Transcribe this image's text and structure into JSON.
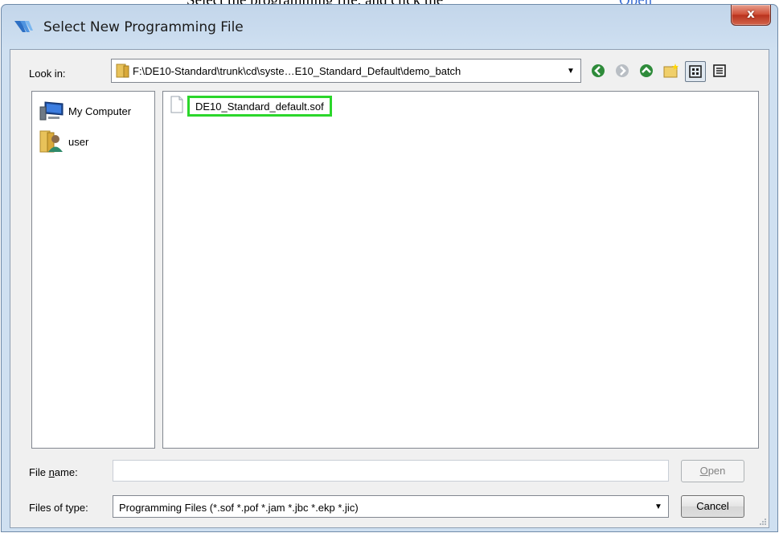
{
  "background_doc": {
    "text_left": "Select the programming file, and click the",
    "text_right": "Open"
  },
  "window": {
    "title": "Select New Programming File",
    "close_glyph": "x"
  },
  "look_in": {
    "label": "Look in:",
    "path": "F:\\DE10-Standard\\trunk\\cd\\syste…E10_Standard_Default\\demo_batch",
    "arrow": "▼"
  },
  "toolbar": {
    "icons": [
      "back-icon",
      "forward-icon",
      "up-folder-icon",
      "new-folder-icon",
      "list-view-icon",
      "detail-view-icon"
    ]
  },
  "places": {
    "items": [
      {
        "label": "My Computer",
        "icon": "computer-icon"
      },
      {
        "label": "user",
        "icon": "user-folder-icon"
      }
    ]
  },
  "files": [
    {
      "name": "DE10_Standard_default.sof",
      "icon": "file-icon",
      "highlight_color": "#2bd62b"
    }
  ],
  "file_name": {
    "label_pre": "File ",
    "label_u": "n",
    "label_post": "ame:",
    "value": ""
  },
  "file_type": {
    "label": "Files of type:",
    "value": "Programming Files (*.sof *.pof *.jam *.jbc *.ekp *.jic)",
    "arrow": "▼"
  },
  "buttons": {
    "open_u": "O",
    "open_rest": "pen",
    "open_enabled": false,
    "cancel": "Cancel"
  },
  "colors": {
    "title_bar": "#c9dbee",
    "close_button": "#cf4b33",
    "highlight": "#2bd62b"
  }
}
